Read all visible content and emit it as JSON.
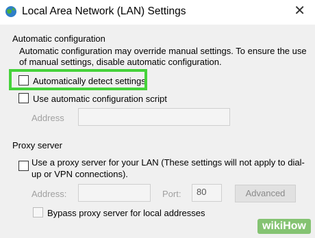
{
  "window": {
    "title": "Local Area Network (LAN) Settings",
    "close_glyph": "✕"
  },
  "auto_config": {
    "heading": "Automatic configuration",
    "description": "Automatic configuration may override manual settings.  To ensure the use of manual settings, disable automatic configuration.",
    "detect_label": "Automatically detect settings",
    "script_label": "Use automatic configuration script",
    "address_label": "Address",
    "address_value": ""
  },
  "proxy": {
    "heading": "Proxy server",
    "use_proxy_label": "Use a proxy server for your LAN (These settings will not apply to dial-up or VPN connections).",
    "address_label": "Address:",
    "address_value": "",
    "port_label": "Port:",
    "port_value": "80",
    "advanced_label": "Advanced",
    "bypass_label": "Bypass proxy server for local addresses"
  },
  "watermark": "wikiHow",
  "colors": {
    "highlight": "#45d23a",
    "dialog_bg": "#f0f0f0",
    "disabled_text": "#a0a0a0"
  },
  "icons": {
    "title_icon": "network-globe-icon",
    "close_icon": "close-icon"
  }
}
